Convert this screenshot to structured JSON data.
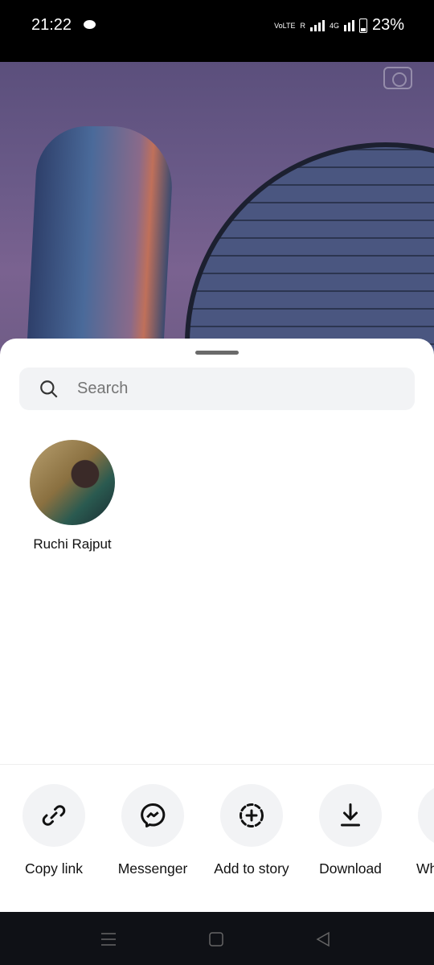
{
  "status_bar": {
    "time": "21:22",
    "network_label": "VoLTE",
    "roaming": "R",
    "network_type": "4G",
    "battery": "23%",
    "battery_level": 23
  },
  "search": {
    "placeholder": "Search",
    "value": ""
  },
  "contacts": [
    {
      "name": "Ruchi Rajput"
    }
  ],
  "share_actions": [
    {
      "label": "Copy link",
      "icon": "link-icon"
    },
    {
      "label": "Messenger",
      "icon": "messenger-icon"
    },
    {
      "label": "Add to story",
      "icon": "add-story-icon"
    },
    {
      "label": "Download",
      "icon": "download-icon"
    },
    {
      "label": "WhatsApp",
      "icon": "whatsapp-icon"
    }
  ],
  "colors": {
    "sheet": "#ffffff",
    "action_bg": "#f2f3f5",
    "nav_bar": "#0f1116"
  }
}
